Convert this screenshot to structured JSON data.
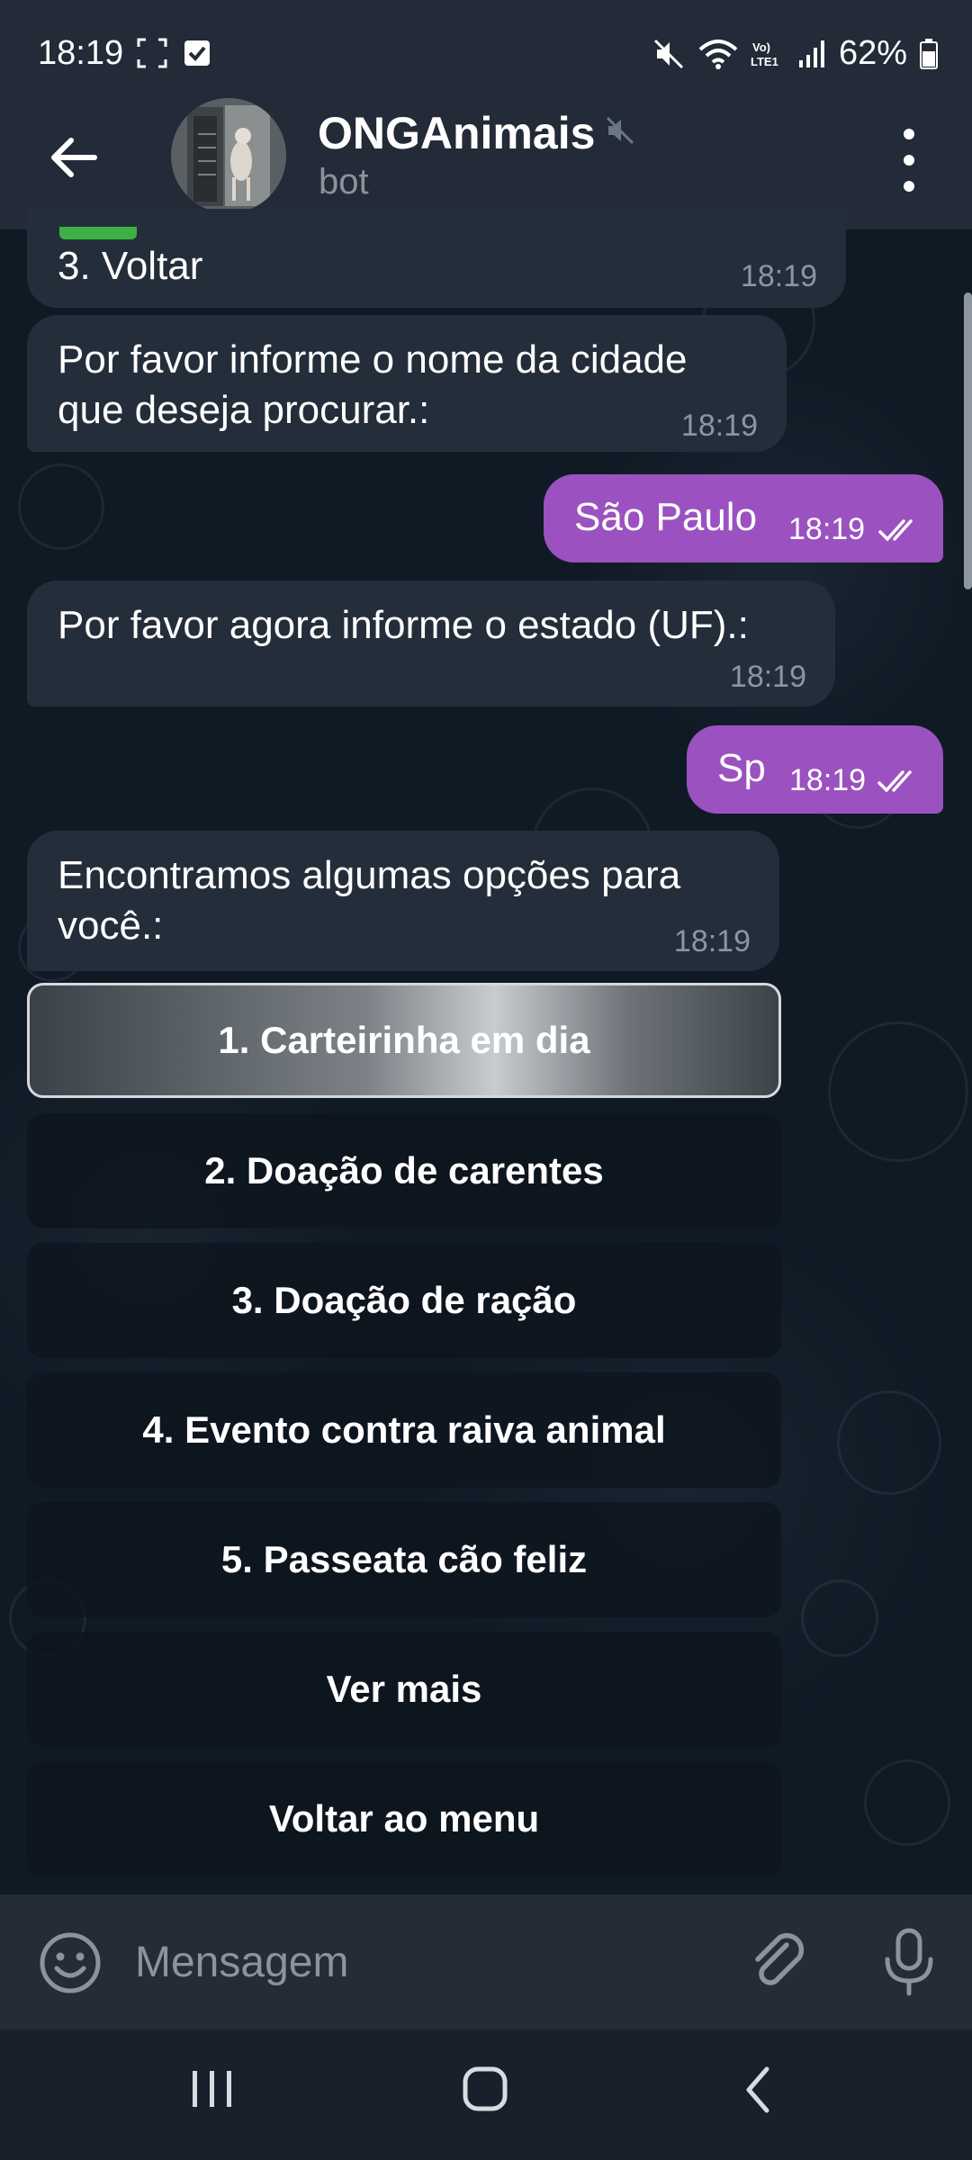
{
  "status_bar": {
    "time": "18:19",
    "battery": "62%"
  },
  "header": {
    "title": "ONGAnimais",
    "subtitle": "bot"
  },
  "messages": [
    {
      "text": "3. Voltar",
      "time": "18:19",
      "direction": "in"
    },
    {
      "text": "Por favor informe o nome da cidade\nque deseja procurar.:",
      "time": "18:19",
      "direction": "in"
    },
    {
      "text": "São Paulo",
      "time": "18:19",
      "direction": "out",
      "status": "read"
    },
    {
      "text": "Por favor agora informe o estado (UF).:",
      "time": "18:19",
      "direction": "in"
    },
    {
      "text": "Sp",
      "time": "18:19",
      "direction": "out",
      "status": "read"
    },
    {
      "text": "Encontramos algumas opções para\nvocê.:",
      "time": "18:19",
      "direction": "in"
    }
  ],
  "keyboard_buttons": [
    {
      "label": "1. Carteirinha em dia",
      "selected": true
    },
    {
      "label": "2. Doação de carentes"
    },
    {
      "label": "3. Doação de ração"
    },
    {
      "label": "4. Evento contra raiva animal"
    },
    {
      "label": "5. Passeata cão feliz"
    },
    {
      "label": "Ver mais"
    },
    {
      "label": "Voltar ao menu"
    }
  ],
  "input": {
    "placeholder": "Mensagem"
  },
  "icons": {
    "back": "arrow-left-icon",
    "muted": "speaker-muted-icon",
    "menu": "more-vertical-icon",
    "emoji": "emoji-icon",
    "attach": "paperclip-icon",
    "mic": "microphone-icon",
    "read_receipt": "double-check-icon"
  },
  "colors": {
    "outgoing_bubble": "#9b51c0",
    "incoming_bubble": "#232e3a",
    "header_bg": "#222b37",
    "chat_bg": "#101a25"
  }
}
